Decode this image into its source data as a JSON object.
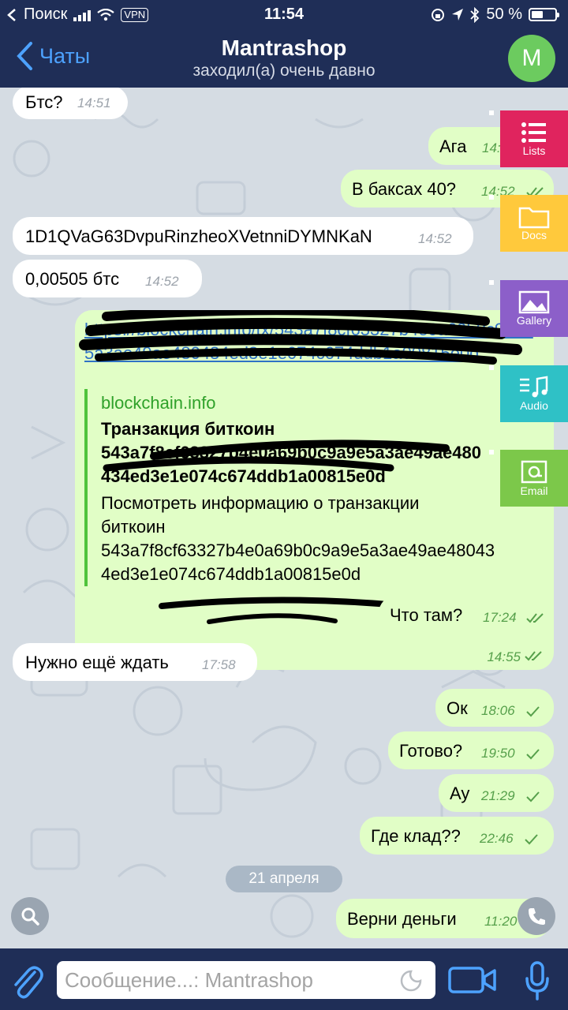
{
  "status": {
    "carrier": "Поиск",
    "vpn": "VPN",
    "time": "11:54",
    "battery": "50 %"
  },
  "header": {
    "back_label": "Чаты",
    "title": "Mantrashop",
    "subtitle": "заходил(а) очень давно",
    "avatar_letter": "M"
  },
  "messages": [
    {
      "dir": "in",
      "text": "Бтс?",
      "time": "14:51"
    },
    {
      "dir": "out",
      "text": "Ага",
      "time": "14:52"
    },
    {
      "dir": "out",
      "text": "В баксах 40?",
      "time": "14:52"
    },
    {
      "dir": "in",
      "text": "1D1QVaG63DvpuRinzheoXVetnniDYMNKaN",
      "time": "14:52"
    },
    {
      "dir": "in",
      "text": "0,00505 бтс",
      "time": "14:52"
    },
    {
      "dir": "out",
      "text": "Что там?",
      "time": "17:24"
    },
    {
      "dir": "in",
      "text": "Нужно ещё ждать",
      "time": "17:58"
    },
    {
      "dir": "out",
      "text": "Ок",
      "time": "18:06"
    },
    {
      "dir": "out",
      "text": "Готово?",
      "time": "19:50"
    },
    {
      "dir": "out",
      "text": "Ау",
      "time": "21:29"
    },
    {
      "dir": "out",
      "text": "Где клад??",
      "time": "22:46"
    },
    {
      "dir": "out",
      "text": "Верни деньги",
      "time": "11:20"
    }
  ],
  "link_message": {
    "url": "https://blockchain.info/tx/543a7f8cf63327b4e0a69b0c9a9e5a3ae49ae480434ed3e1e074c674ddb1a00815e0d",
    "site": "blockchain.info",
    "preview_title": "Транзакция биткоин\n543a7f8cf63327b4e0a69b0c9a9e5a3ae49ae480\n434ed3e1e074c674ddb1a00815e0d",
    "preview_desc": "Посмотреть информацию о транзакции\nбиткоин\n543a7f8cf63327b4e0a69b0c9a9e5a3ae49ae48043\n4ed3e1e074c674ddb1a00815e0d",
    "time": "14:55"
  },
  "date_separator": "21 апреля",
  "side_tabs": [
    {
      "label": "Lists",
      "color": "#e0245e",
      "icon": "list-icon"
    },
    {
      "label": "Docs",
      "color": "#ffc93c",
      "icon": "folder-icon"
    },
    {
      "label": "Gallery",
      "color": "#8c5fc9",
      "icon": "image-icon"
    },
    {
      "label": "Audio",
      "color": "#2fc1c6",
      "icon": "music-note-icon"
    },
    {
      "label": "Email",
      "color": "#7cc84a",
      "icon": "at-icon"
    }
  ],
  "composer": {
    "placeholder": "Сообщение...: Mantrashop"
  }
}
